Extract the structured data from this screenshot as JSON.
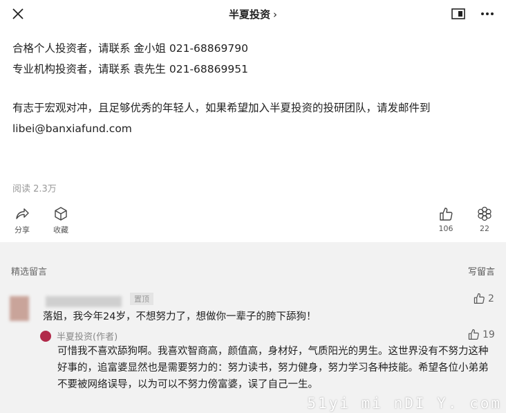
{
  "header": {
    "title": "半夏投资",
    "title_chevron": "›"
  },
  "article": {
    "lines": [
      "合格个人投资者，请联系 金小姐 021-68869790",
      "专业机构投资者，请联系 袁先生 021-68869951",
      "有志于宏观对冲，且足够优秀的年轻人，如果希望加入半夏投资的投研团队，请发邮件到",
      "libei@banxiafund.com"
    ],
    "read_count": "阅读 2.3万"
  },
  "actions": {
    "share_label": "分享",
    "collect_label": "收藏",
    "like_count": "106",
    "wow_count": "22"
  },
  "comments": {
    "section_title": "精选留言",
    "write_label": "写留言",
    "items": [
      {
        "pinned_label": "置顶",
        "text": "落姐，我今年24岁，不想努力了，想做你一辈子的胯下舔狗！",
        "likes": "2",
        "reply": {
          "author": "半夏投资(作者)",
          "likes": "19",
          "text": "可惜我不喜欢舔狗啊。我喜欢智商高，颜值高，身材好，气质阳光的男生。这世界没有不努力这种好事的，追富婆显然也是需要努力的：努力读书，努力健身，努力学习各种技能。希望各位小弟弟不要被网络误导，以为可以不努力傍富婆，误了自己一生。"
        }
      }
    ]
  },
  "watermark": "51yi mi nDI Y. com",
  "colors": {
    "comment_bg": "#f2f2f2",
    "avatar": "#b12a4a"
  }
}
